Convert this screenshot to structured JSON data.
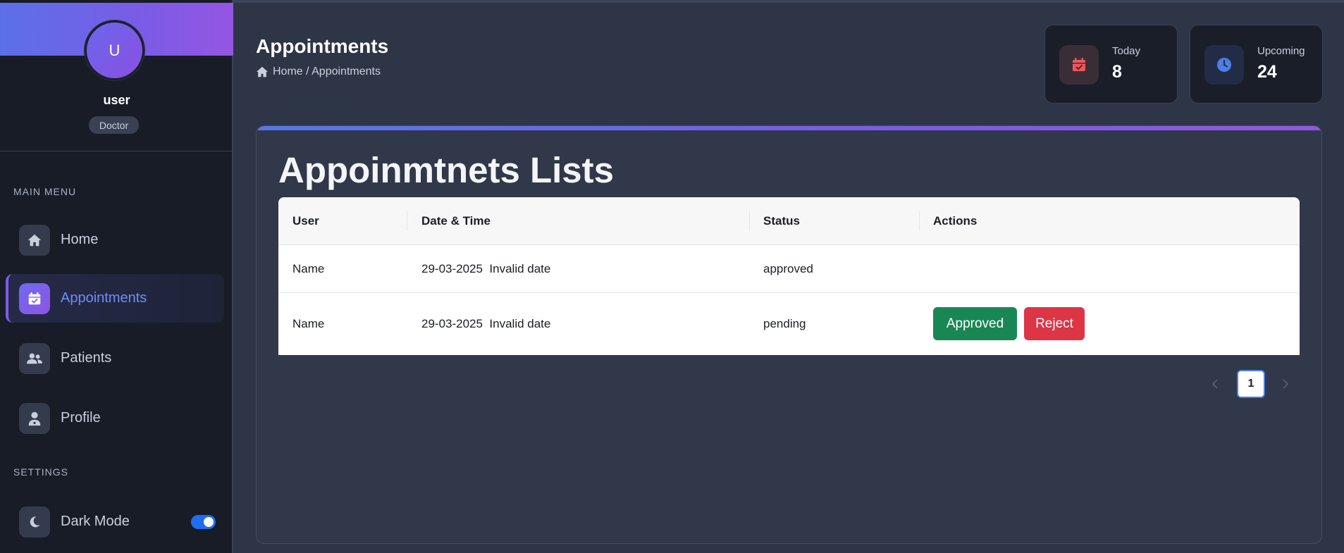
{
  "sidebar": {
    "avatar_initial": "U",
    "user_name": "user",
    "role": "Doctor",
    "main_menu_label": "MAIN MENU",
    "settings_label": "SETTINGS",
    "items": [
      {
        "label": "Home",
        "icon": "home-icon",
        "active": false
      },
      {
        "label": "Appointments",
        "icon": "calendar-check-icon",
        "active": true
      },
      {
        "label": "Patients",
        "icon": "users-icon",
        "active": false
      },
      {
        "label": "Profile",
        "icon": "user-doctor-icon",
        "active": false
      }
    ],
    "dark_mode": {
      "label": "Dark Mode",
      "icon": "moon-icon",
      "enabled": true
    }
  },
  "header": {
    "title": "Appointments",
    "breadcrumb": "Home / Appointments"
  },
  "stats": [
    {
      "label": "Today",
      "value": "8",
      "icon": "calendar-check-icon",
      "color": "#f0565a"
    },
    {
      "label": "Upcoming",
      "value": "24",
      "icon": "clock-icon",
      "color": "#4b7fe6"
    }
  ],
  "card": {
    "title": "Appoinmtnets Lists"
  },
  "table": {
    "columns": [
      "User",
      "Date & Time",
      "Status",
      "Actions"
    ],
    "rows": [
      {
        "user": "Name",
        "datetime": "29-03-2025  Invalid date",
        "status": "approved",
        "actions": []
      },
      {
        "user": "Name",
        "datetime": "29-03-2025  Invalid date",
        "status": "pending",
        "actions": [
          "Approved",
          "Reject"
        ]
      }
    ]
  },
  "pagination": {
    "current_page": "1"
  },
  "colors": {
    "accent": "#7a5ce6",
    "approve": "#198754",
    "reject": "#dc3545",
    "toggle": "#1f6ef0"
  }
}
